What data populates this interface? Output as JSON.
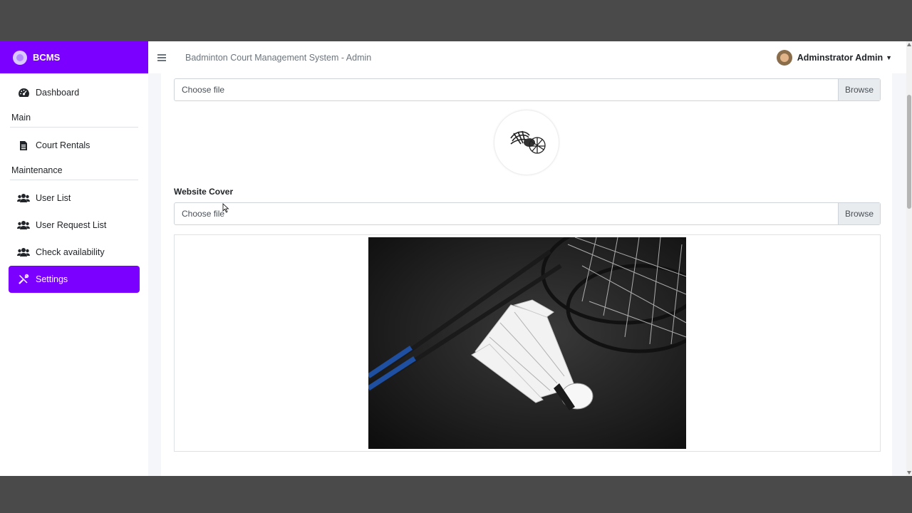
{
  "brand": {
    "name": "BCMS"
  },
  "topbar": {
    "title": "Badminton Court Management System - Admin",
    "user_name": "Adminstrator Admin"
  },
  "sidebar": {
    "dashboard": "Dashboard",
    "header_main": "Main",
    "court_rentals": "Court Rentals",
    "header_maintenance": "Maintenance",
    "user_list": "User List",
    "user_request_list": "User Request List",
    "check_availability": "Check availability",
    "settings": "Settings"
  },
  "form": {
    "logo_file_text": "Choose file",
    "logo_browse": "Browse",
    "cover_label": "Website Cover",
    "cover_file_text": "Choose file",
    "cover_browse": "Browse"
  },
  "colors": {
    "accent": "#7b00ff",
    "sidebar_bg": "#ffffff",
    "page_bg": "#f4f6f9"
  },
  "icons": {
    "brand": "brand-logo-icon",
    "dashboard": "tachometer-icon",
    "court_rentals": "file-icon",
    "user_list": "users-icon",
    "user_request_list": "users-icon",
    "check_availability": "users-icon",
    "settings": "tools-icon",
    "menu": "hamburger-icon"
  }
}
